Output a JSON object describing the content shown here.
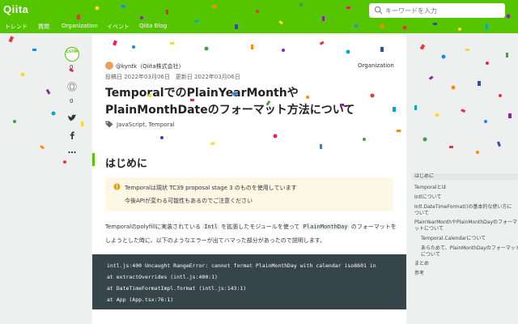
{
  "header": {
    "logo": "Qiita",
    "search_placeholder": "キーワードを入力",
    "nav": [
      "トレンド",
      "質問",
      "Organization",
      "イベント",
      "Qiita Blog"
    ]
  },
  "left_rail": {
    "lgtm_label": "LGTM",
    "lgtm_count": "0",
    "stock_count": "0"
  },
  "article": {
    "author": "@kyntk（Qiita株式会社）",
    "organization": "Organization",
    "dates": "投稿日 2022年03月06日　更新日 2022年03月06日",
    "title": "TemporalでのPlainYearMonthやPlainMonthDateのフォーマット方法について",
    "tags": "JavaScript, Temporal",
    "heading": "はじめに",
    "note_line1": "Temporalは現状 TC39 proposal stage 3 のものを使用しています",
    "note_line2": "今後APIが変わる可能性もあるのでご注意ください",
    "para_a": "Temporalのpolyfillに実装されている ",
    "para_code1": "Intl",
    "para_b": " を拡張したモジュールを使って ",
    "para_code2": "PlainMonthDay",
    "para_c": " のフォーマットをしようとした時に、以下のようなエラーが出てハマった部分があったので説明します。",
    "code_lines": [
      "intl.js:400 Uncaught RangeError: cannot format PlainMonthDay with calendar iso8601 in",
      "    at extractOverrides (intl.js:400:1)",
      "    at DateTimeFormatImpl.format (intl.js:143:1)",
      "    at App (App.tsx:76:1)"
    ]
  },
  "toc": [
    "はじめに",
    "Temporalとは",
    "Intlについて",
    "Intl.DateTimeFormat()の基本的な使い方に",
    "ついて",
    "PlainYearMonthやPlainMonthDayのフォーマ",
    "ットについて",
    "Temporal.Calendarについて",
    "あらためて、PlainMonthDayのフォーマット",
    "について",
    "まとめ",
    "参考"
  ],
  "colors": {
    "brand": "#55c500",
    "code_bg": "#364549",
    "note_bg": "#fdf8e4"
  }
}
